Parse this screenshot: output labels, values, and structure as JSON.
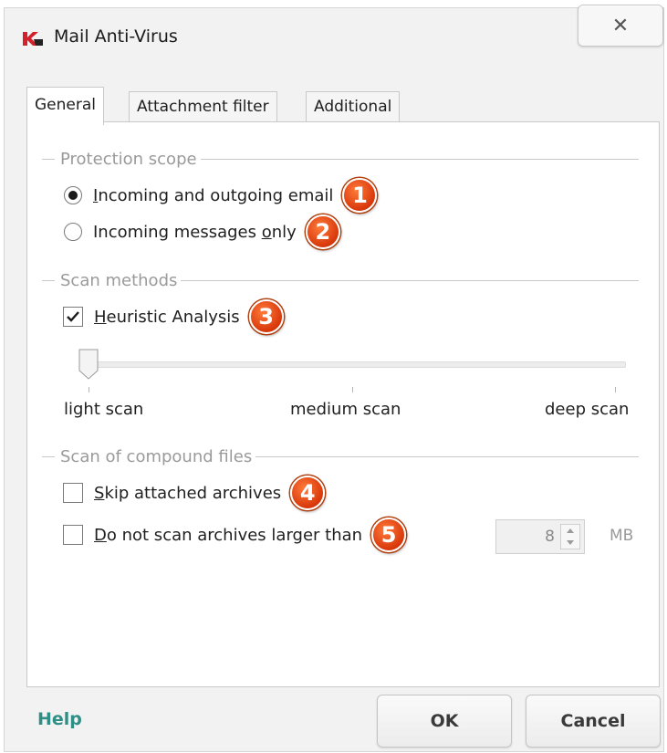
{
  "window": {
    "title": "Mail Anti-Virus",
    "close_glyph": "✕"
  },
  "tabs": [
    {
      "label": "General",
      "active": true
    },
    {
      "label": "Attachment filter",
      "active": false
    },
    {
      "label": "Additional",
      "active": false
    }
  ],
  "protection_scope": {
    "heading": "Protection scope",
    "options": [
      {
        "label_parts": [
          "",
          "I",
          "ncoming and outgoing email"
        ],
        "selected": true,
        "badge": "1"
      },
      {
        "label_parts": [
          "Incoming messages ",
          "o",
          "nly"
        ],
        "selected": false,
        "badge": "2"
      }
    ]
  },
  "scan_methods": {
    "heading": "Scan methods",
    "heuristic": {
      "label_parts": [
        "",
        "H",
        "euristic Analysis"
      ],
      "checked": true,
      "badge": "3"
    },
    "level": {
      "labels": [
        "light scan",
        "medium scan",
        "deep scan"
      ],
      "selected_index": 0
    }
  },
  "compound_files": {
    "heading": "Scan of compound files",
    "skip_archives": {
      "label_parts": [
        "",
        "S",
        "kip attached archives"
      ],
      "checked": false,
      "badge": "4"
    },
    "size_limit": {
      "label_parts": [
        "",
        "D",
        "o not scan archives larger than"
      ],
      "checked": false,
      "badge": "5"
    },
    "size_value": "8",
    "size_unit": "MB"
  },
  "footer": {
    "help_label": "Help",
    "ok_label": "OK",
    "cancel_label": "Cancel"
  },
  "colors": {
    "badge": "#d8380a",
    "help_link": "#2f8e85",
    "group_heading": "#9a9a9a",
    "brand_red": "#d4202a"
  },
  "icons": {
    "app": "kaspersky-k-icon",
    "close": "close-icon",
    "check": "checkmark-icon",
    "spin_up": "chevron-up-icon",
    "spin_down": "chevron-down-icon"
  }
}
